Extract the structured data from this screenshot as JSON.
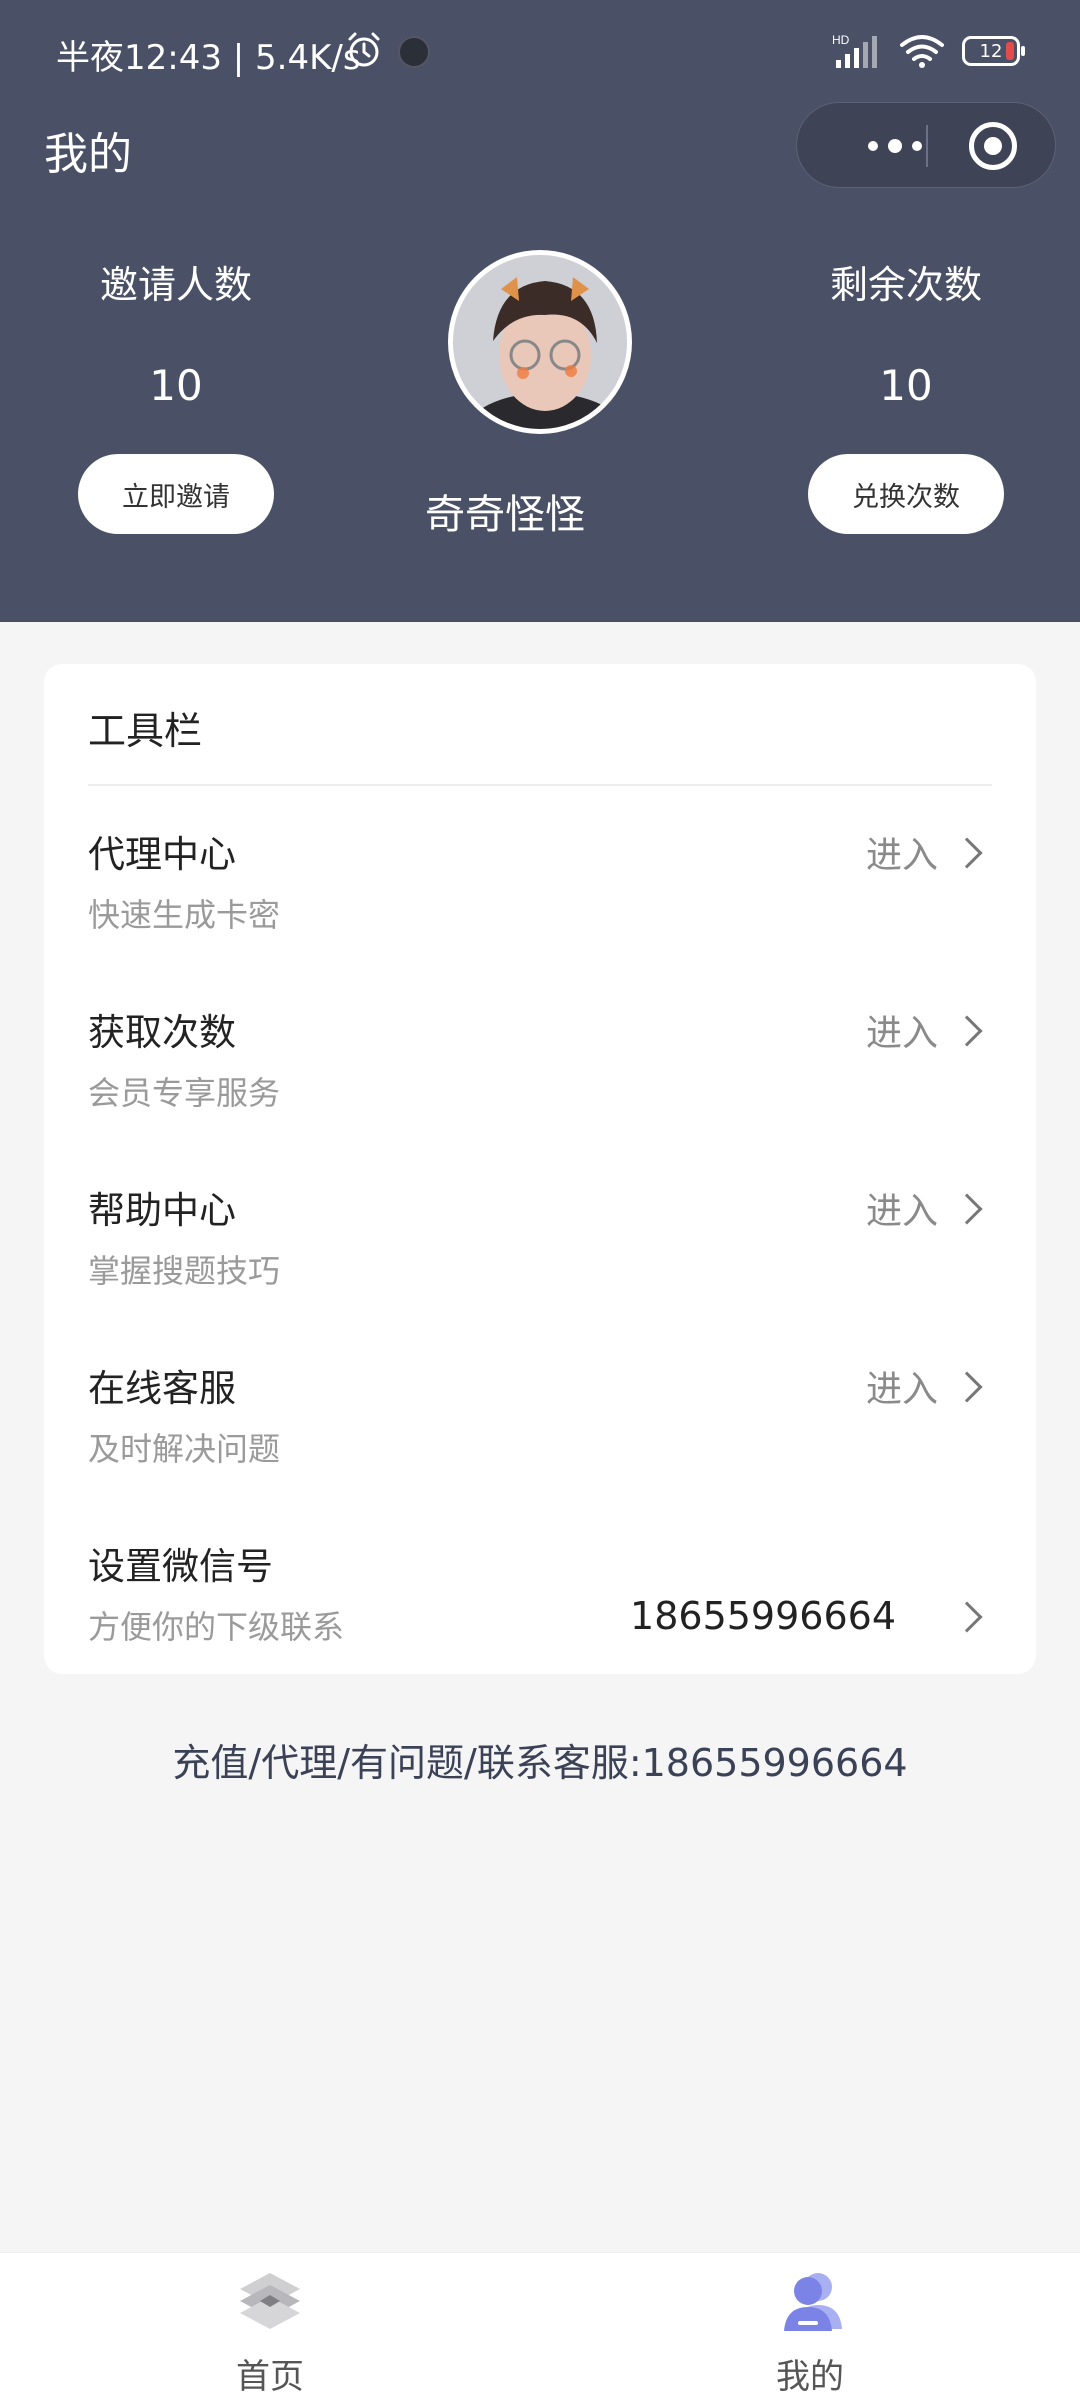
{
  "status": {
    "time_speed": "半夜12:43 | 5.4K/s",
    "network": "HD",
    "battery": "12"
  },
  "header": {
    "title": "我的",
    "username": "奇奇怪怪",
    "invite": {
      "label": "邀请人数",
      "value": "10",
      "button": "立即邀请"
    },
    "remaining": {
      "label": "剩余次数",
      "value": "10",
      "button": "兑换次数"
    }
  },
  "toolbar": {
    "title": "工具栏",
    "items": [
      {
        "title": "代理中心",
        "subtitle": "快速生成卡密",
        "action": "进入"
      },
      {
        "title": "获取次数",
        "subtitle": "会员专享服务",
        "action": "进入"
      },
      {
        "title": "帮助中心",
        "subtitle": "掌握搜题技巧",
        "action": "进入"
      },
      {
        "title": "在线客服",
        "subtitle": "及时解决问题",
        "action": "进入"
      },
      {
        "title": "设置微信号",
        "subtitle": "方便你的下级联系",
        "value": "18655996664"
      }
    ]
  },
  "contact": "充值/代理/有问题/联系客服:18655996664",
  "tabbar": {
    "home": "首页",
    "mine": "我的",
    "active_color": "#7b84e6"
  },
  "colors": {
    "header_bg": "#4a5065",
    "page_bg": "#f5f5f6"
  }
}
